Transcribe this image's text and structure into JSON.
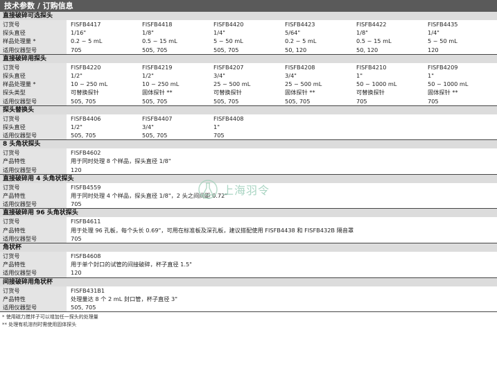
{
  "title": "技术参数 / 订购信息",
  "sections": [
    {
      "header": "直接破碎可选探头",
      "rows": [
        {
          "label": "订货号",
          "values": [
            "FISFB4417",
            "FISFB4418",
            "FISFB4420",
            "FISFB4423",
            "FISFB4422",
            "FISFB4435"
          ]
        },
        {
          "label": "探头直径",
          "values": [
            "1/16\"",
            "1/8\"",
            "1/4\"",
            "5/64\"",
            "1/8\"",
            "1/4\""
          ]
        },
        {
          "label": "样品处理量 *",
          "values": [
            "0.2 ~ 5 mL",
            "0.5 ~ 15 mL",
            "5 ~ 50 mL",
            "0.2 ~ 5 mL",
            "0.5 ~ 15 mL",
            "5 ~ 50 mL"
          ]
        },
        {
          "label": "适用仪器型号",
          "values": [
            "705",
            "505, 705",
            "505, 705",
            "50, 120",
            "50, 120",
            "120"
          ]
        }
      ]
    },
    {
      "header": "直接破碎用探头",
      "rows": [
        {
          "label": "订货号",
          "values": [
            "FISFB4220",
            "FISFB4219",
            "FISFB4207",
            "FISFB4208",
            "FISFB4210",
            "FISFB4209"
          ]
        },
        {
          "label": "探头直径",
          "values": [
            "1/2\"",
            "1/2\"",
            "3/4\"",
            "3/4\"",
            "1\"",
            "1\""
          ]
        },
        {
          "label": "样品处理量 *",
          "values": [
            "10 ~ 250 mL",
            "10 ~ 250 mL",
            "25 ~ 500 mL",
            "25 ~ 500 mL",
            "50 ~ 1000 mL",
            "50 ~ 1000 mL"
          ]
        },
        {
          "label": "探头类型",
          "values": [
            "可替换探针",
            "固体探针 **",
            "可替换探针",
            "固体探针 **",
            "可替换探针",
            "固体探针 **"
          ]
        },
        {
          "label": "适用仪器型号",
          "values": [
            "505, 705",
            "505, 705",
            "505, 705",
            "505, 705",
            "705",
            "705"
          ]
        }
      ]
    },
    {
      "header": "探头替换头",
      "rows": [
        {
          "label": "订货号",
          "values": [
            "FISFB4406",
            "FISFB4407",
            "FISFB4408"
          ]
        },
        {
          "label": "探头直径",
          "values": [
            "1/2\"",
            "3/4\"",
            "1\""
          ]
        },
        {
          "label": "适用仪器型号",
          "values": [
            "505, 705",
            "505, 705",
            "705"
          ]
        }
      ]
    },
    {
      "header": "8 头角状探头",
      "rows": [
        {
          "label": "订货号",
          "desc": "FISFB4602"
        },
        {
          "label": "产品特性",
          "desc": "用于同时处理 8 个样品，探头直径 1/8\""
        },
        {
          "label": "适用仪器型号",
          "desc": "120"
        }
      ]
    },
    {
      "header": "直接破碎用 4 头角状探头",
      "rows": [
        {
          "label": "订货号",
          "desc": "FISFB4559"
        },
        {
          "label": "产品特性",
          "desc": "用于同时处理 4 个样品，探头直径 1/8\"，2 头之间间距 0.72\""
        },
        {
          "label": "适用仪器型号",
          "desc": "705"
        }
      ]
    },
    {
      "header": "直接破碎用 96 头角状探头",
      "rows": [
        {
          "label": "订货号",
          "desc": "FISFB4611"
        },
        {
          "label": "产品特性",
          "desc": "用于处理 96 孔板，每个头长 0.69\"，可用在标准板及深孔板，建议搭配使用 FISFB4438 和 FISFB432B 隔音罩"
        },
        {
          "label": "适用仪器型号",
          "desc": "705"
        }
      ]
    },
    {
      "header": "角状杯",
      "rows": [
        {
          "label": "订货号",
          "desc": "FISFB4608"
        },
        {
          "label": "产品特性",
          "desc": "用于单个封口的试管的间接破碎，杯子直径 1.5\""
        },
        {
          "label": "适用仪器型号",
          "desc": "120"
        }
      ]
    },
    {
      "header": "间接破碎用角状杯",
      "rows": [
        {
          "label": "订货号",
          "desc": "FISFB431B1"
        },
        {
          "label": "产品特性",
          "desc": "处理量达 8 个 2 mL 封口管，杯子直径 3\""
        },
        {
          "label": "适用仪器型号",
          "desc": "505, 705"
        }
      ]
    }
  ],
  "footnotes": [
    "* 使用磁力搅拌子可以增加任一探头的处理量",
    "** 处理有机溶剂时需使用固体探头"
  ],
  "watermark": {
    "text": "上海羽令",
    "icon": "flask-logo-icon"
  }
}
